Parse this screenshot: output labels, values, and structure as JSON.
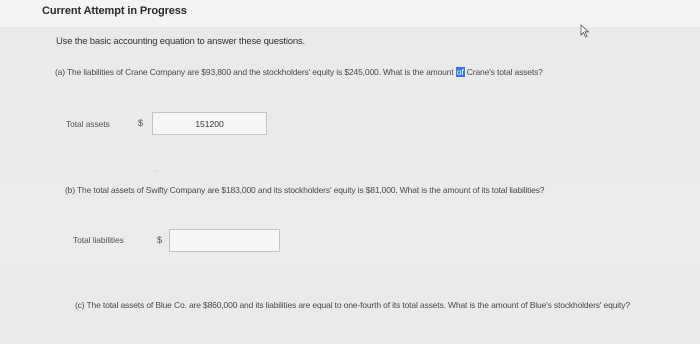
{
  "header": {
    "title": "Current Attempt in Progress"
  },
  "instruction": "Use the basic accounting equation to answer these questions.",
  "questions": {
    "a": {
      "text_before": "(a) The liabilities of Crane Company are $93,800 and the stockholders' equity is $245,000. What is the amount",
      "highlight": "of",
      "text_after": "Crane's total assets?",
      "answer_label": "Total assets",
      "currency": "$",
      "answer_value": "151200"
    },
    "b": {
      "text": "(b) The total assets of Swifty Company are $183,000 and its stockholders' equity is $81,000. What is the amount of its total liabilities?",
      "answer_label": "Total liabilities",
      "currency": "$",
      "answer_value": ""
    },
    "c": {
      "text": "(c) The total assets of Blue Co. are $860,000 and its liabilities are equal to one-fourth of its total assets. What is the amount of Blue's stockholders' equity?"
    }
  },
  "colors": {
    "highlight": "#3a78d8",
    "background": "#ececec"
  },
  "icons": {
    "pointer": "mouse-pointer-icon"
  }
}
